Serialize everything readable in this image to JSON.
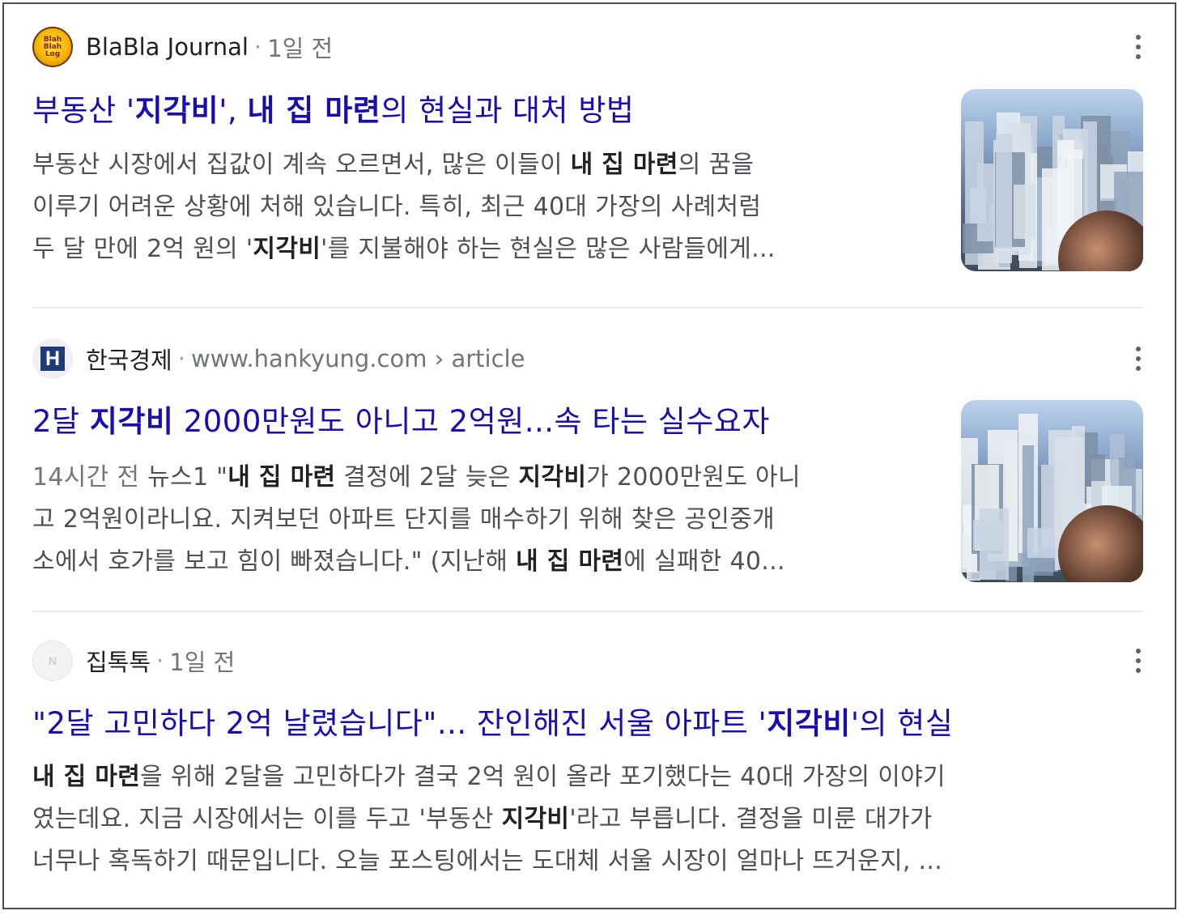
{
  "results": [
    {
      "source": {
        "site": "BlaBla Journal",
        "meta": "1일 전",
        "favicon_text": [
          "Blah",
          "Blah",
          "Log"
        ],
        "favicon": "blablajournal-logo"
      },
      "title": [
        {
          "t": "부동산 '",
          "b": false
        },
        {
          "t": "지각비",
          "b": true
        },
        {
          "t": "', ",
          "b": false
        },
        {
          "t": "내 집 마련",
          "b": true
        },
        {
          "t": "의 현실과 대처 방법",
          "b": false
        }
      ],
      "snippet": [
        [
          {
            "t": "부동산 시장에서 집값이 계속 오르면서, 많은 이들이 ",
            "b": false
          },
          {
            "t": "내 집 마련",
            "b": true
          },
          {
            "t": "의 꿈을",
            "b": false
          }
        ],
        [
          {
            "t": "이루기 어려운 상황에 처해 있습니다. 특히, 최근 40대 가장의 사례처럼",
            "b": false
          }
        ],
        [
          {
            "t": "두 달 만에 2억 원의 '",
            "b": false
          },
          {
            "t": "지각비",
            "b": true
          },
          {
            "t": "'를 지불해야 하는 현실은 많은 사람들에게...",
            "b": false
          }
        ]
      ],
      "has_thumbnail": true,
      "more_icon": "more-vert-icon"
    },
    {
      "source": {
        "site": "한국경제",
        "meta": "www.hankyung.com › article",
        "favicon_text": [
          "H"
        ],
        "favicon": "hankyung-logo"
      },
      "title": [
        {
          "t": "2달 ",
          "b": false
        },
        {
          "t": "지각비",
          "b": true
        },
        {
          "t": " 2000만원도 아니고 2억원...속 타는 실수요자",
          "b": false
        }
      ],
      "snippet": [
        [
          {
            "t": "14시간 전",
            "b": false,
            "date": true
          },
          {
            "t": "  뉴스1 \"",
            "b": false
          },
          {
            "t": "내 집 마련",
            "b": true
          },
          {
            "t": " 결정에 2달 늦은 ",
            "b": false
          },
          {
            "t": "지각비",
            "b": true
          },
          {
            "t": "가 2000만원도 아니",
            "b": false
          }
        ],
        [
          {
            "t": "고 2억원이라니요. 지켜보던 아파트 단지를 매수하기 위해 찾은 공인중개",
            "b": false
          }
        ],
        [
          {
            "t": "소에서 호가를 보고 힘이 빠졌습니다.\" (지난해 ",
            "b": false
          },
          {
            "t": "내 집 마련",
            "b": true
          },
          {
            "t": "에 실패한 40...",
            "b": false
          }
        ]
      ],
      "has_thumbnail": true,
      "more_icon": "more-vert-icon"
    },
    {
      "source": {
        "site": "집톡톡",
        "meta": "1일 전",
        "favicon_text": [
          "N"
        ],
        "favicon": "ziptoktok-logo"
      },
      "title": [
        {
          "t": "\"2달 고민하다 2억 날렸습니다\"... 잔인해진 서울 아파트 '",
          "b": false
        },
        {
          "t": "지각비",
          "b": true
        },
        {
          "t": "'의 현실",
          "b": false
        }
      ],
      "snippet": [
        [
          {
            "t": "내 집 마련",
            "b": true
          },
          {
            "t": "을 위해 2달을 고민하다가 결국 2억 원이 올라 포기했다는 40대 가장의 이야기",
            "b": false
          }
        ],
        [
          {
            "t": "였는데요. 지금 시장에서는 이를 두고 '부동산 ",
            "b": false
          },
          {
            "t": "지각비",
            "b": true
          },
          {
            "t": "'라고 부릅니다. 결정을 미룬 대가가",
            "b": false
          }
        ],
        [
          {
            "t": "너무나 혹독하기 때문입니다. 오늘 포스팅에서는 도대체 서울 시장이 얼마나 뜨거운지, ...",
            "b": false
          }
        ]
      ],
      "has_thumbnail": false,
      "more_icon": "more-vert-icon"
    }
  ],
  "colors": {
    "title_link": "#1a0dab",
    "snippet": "#4d5156",
    "meta": "#70757a"
  }
}
